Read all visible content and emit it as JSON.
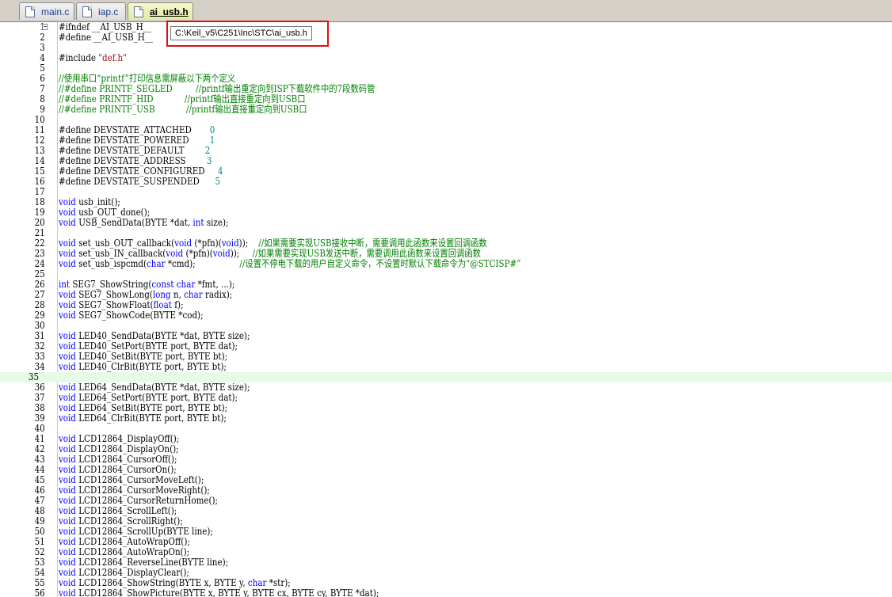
{
  "tabs": [
    {
      "label": "main.c",
      "active": false
    },
    {
      "label": "iap.c",
      "active": false
    },
    {
      "label": "ai_usb.h",
      "active": true
    }
  ],
  "tooltip": "C:\\Keil_v5\\C251\\Inc\\STC\\ai_usb.h",
  "current_line": 35,
  "lines": [
    [
      [
        "pp",
        "#ifndef __AI_USB_H__"
      ]
    ],
    [
      [
        "pp",
        "#define __AI_USB_H__"
      ]
    ],
    [],
    [
      [
        "pp",
        "#include "
      ],
      [
        "str",
        "\"def.h\""
      ]
    ],
    [],
    [
      [
        "cm",
        "//使用串口“printf”打印信息需屏蔽以下两个定义"
      ]
    ],
    [
      [
        "cm",
        "//#define PRINTF_SEGLED         //printf输出重定向到ISP下载软件中的7段数码管"
      ]
    ],
    [
      [
        "cm",
        "//#define PRINTF_HID            //printf输出直接重定向到USB口"
      ]
    ],
    [
      [
        "cm",
        "//#define PRINTF_USB            //printf输出直接重定向到USB口"
      ]
    ],
    [],
    [
      [
        "pp",
        "#define DEVSTATE_ATTACHED       "
      ],
      [
        "num",
        "0"
      ]
    ],
    [
      [
        "pp",
        "#define DEVSTATE_POWERED        "
      ],
      [
        "num",
        "1"
      ]
    ],
    [
      [
        "pp",
        "#define DEVSTATE_DEFAULT        "
      ],
      [
        "num",
        "2"
      ]
    ],
    [
      [
        "pp",
        "#define DEVSTATE_ADDRESS        "
      ],
      [
        "num",
        "3"
      ]
    ],
    [
      [
        "pp",
        "#define DEVSTATE_CONFIGURED     "
      ],
      [
        "num",
        "4"
      ]
    ],
    [
      [
        "pp",
        "#define DEVSTATE_SUSPENDED      "
      ],
      [
        "num",
        "5"
      ]
    ],
    [],
    [
      [
        "kw",
        "void"
      ],
      [
        "pp",
        " usb_init();"
      ]
    ],
    [
      [
        "kw",
        "void"
      ],
      [
        "pp",
        " usb_OUT_done();"
      ]
    ],
    [
      [
        "kw",
        "void"
      ],
      [
        "pp",
        " USB_SendData(BYTE *dat, "
      ],
      [
        "kw",
        "int"
      ],
      [
        "pp",
        " size);"
      ]
    ],
    [],
    [
      [
        "kw",
        "void"
      ],
      [
        "pp",
        " set_usb_OUT_callback("
      ],
      [
        "kw",
        "void"
      ],
      [
        "pp",
        " (*pfn)("
      ],
      [
        "kw",
        "void"
      ],
      [
        "pp",
        "));    "
      ],
      [
        "cm",
        "//如果需要实现USB接收中断，需要调用此函数来设置回调函数"
      ]
    ],
    [
      [
        "kw",
        "void"
      ],
      [
        "pp",
        " set_usb_IN_callback("
      ],
      [
        "kw",
        "void"
      ],
      [
        "pp",
        " (*pfn)("
      ],
      [
        "kw",
        "void"
      ],
      [
        "pp",
        "));     "
      ],
      [
        "cm",
        "//如果需要实现USB发送中断，需要调用此函数来设置回调函数"
      ]
    ],
    [
      [
        "kw",
        "void"
      ],
      [
        "pp",
        " set_usb_ispcmd("
      ],
      [
        "kw",
        "char"
      ],
      [
        "pp",
        " *cmd);                 "
      ],
      [
        "cm",
        "//设置不停电下载的用户自定义命令，不设置时默认下载命令为“@STCISP#”"
      ]
    ],
    [],
    [
      [
        "kw",
        "int"
      ],
      [
        "pp",
        " SEG7_ShowString("
      ],
      [
        "kw",
        "const char"
      ],
      [
        "pp",
        " *fmt, ...);"
      ]
    ],
    [
      [
        "kw",
        "void"
      ],
      [
        "pp",
        " SEG7_ShowLong("
      ],
      [
        "kw",
        "long"
      ],
      [
        "pp",
        " n, "
      ],
      [
        "kw",
        "char"
      ],
      [
        "pp",
        " radix);"
      ]
    ],
    [
      [
        "kw",
        "void"
      ],
      [
        "pp",
        " SEG7_ShowFloat("
      ],
      [
        "kw",
        "float"
      ],
      [
        "pp",
        " f);"
      ]
    ],
    [
      [
        "kw",
        "void"
      ],
      [
        "pp",
        " SEG7_ShowCode(BYTE *cod);"
      ]
    ],
    [],
    [
      [
        "kw",
        "void"
      ],
      [
        "pp",
        " LED40_SendData(BYTE *dat, BYTE size);"
      ]
    ],
    [
      [
        "kw",
        "void"
      ],
      [
        "pp",
        " LED40_SetPort(BYTE port, BYTE dat);"
      ]
    ],
    [
      [
        "kw",
        "void"
      ],
      [
        "pp",
        " LED40_SetBit(BYTE port, BYTE bt);"
      ]
    ],
    [
      [
        "kw",
        "void"
      ],
      [
        "pp",
        " LED40_ClrBit(BYTE port, BYTE bt);"
      ]
    ],
    [],
    [
      [
        "kw",
        "void"
      ],
      [
        "pp",
        " LED64_SendData(BYTE *dat, BYTE size);"
      ]
    ],
    [
      [
        "kw",
        "void"
      ],
      [
        "pp",
        " LED64_SetPort(BYTE port, BYTE dat);"
      ]
    ],
    [
      [
        "kw",
        "void"
      ],
      [
        "pp",
        " LED64_SetBit(BYTE port, BYTE bt);"
      ]
    ],
    [
      [
        "kw",
        "void"
      ],
      [
        "pp",
        " LED64_ClrBit(BYTE port, BYTE bt);"
      ]
    ],
    [],
    [
      [
        "kw",
        "void"
      ],
      [
        "pp",
        " LCD12864_DisplayOff();"
      ]
    ],
    [
      [
        "kw",
        "void"
      ],
      [
        "pp",
        " LCD12864_DisplayOn();"
      ]
    ],
    [
      [
        "kw",
        "void"
      ],
      [
        "pp",
        " LCD12864_CursorOff();"
      ]
    ],
    [
      [
        "kw",
        "void"
      ],
      [
        "pp",
        " LCD12864_CursorOn();"
      ]
    ],
    [
      [
        "kw",
        "void"
      ],
      [
        "pp",
        " LCD12864_CursorMoveLeft();"
      ]
    ],
    [
      [
        "kw",
        "void"
      ],
      [
        "pp",
        " LCD12864_CursorMoveRight();"
      ]
    ],
    [
      [
        "kw",
        "void"
      ],
      [
        "pp",
        " LCD12864_CursorReturnHome();"
      ]
    ],
    [
      [
        "kw",
        "void"
      ],
      [
        "pp",
        " LCD12864_ScrollLeft();"
      ]
    ],
    [
      [
        "kw",
        "void"
      ],
      [
        "pp",
        " LCD12864_ScrollRight();"
      ]
    ],
    [
      [
        "kw",
        "void"
      ],
      [
        "pp",
        " LCD12864_ScrollUp(BYTE line);"
      ]
    ],
    [
      [
        "kw",
        "void"
      ],
      [
        "pp",
        " LCD12864_AutoWrapOff();"
      ]
    ],
    [
      [
        "kw",
        "void"
      ],
      [
        "pp",
        " LCD12864_AutoWrapOn();"
      ]
    ],
    [
      [
        "kw",
        "void"
      ],
      [
        "pp",
        " LCD12864_ReverseLine(BYTE line);"
      ]
    ],
    [
      [
        "kw",
        "void"
      ],
      [
        "pp",
        " LCD12864_DisplayClear();"
      ]
    ],
    [
      [
        "kw",
        "void"
      ],
      [
        "pp",
        " LCD12864_ShowString(BYTE x, BYTE y, "
      ],
      [
        "kw",
        "char"
      ],
      [
        "pp",
        " *str);"
      ]
    ],
    [
      [
        "kw",
        "void"
      ],
      [
        "pp",
        " LCD12864_ShowPicture(BYTE x, BYTE y, BYTE cx, BYTE cy, BYTE *dat);"
      ]
    ]
  ]
}
